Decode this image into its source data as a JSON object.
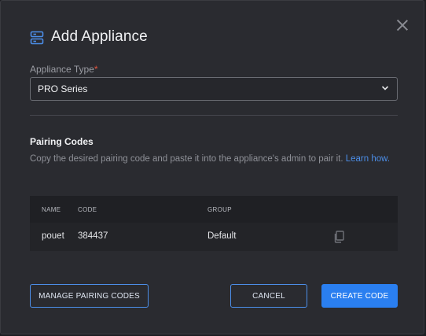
{
  "dialog": {
    "title": "Add Appliance",
    "title_icon": "server-stack-icon",
    "close_icon": "close-icon"
  },
  "appliance_type": {
    "label": "Appliance Type",
    "required_mark": "*",
    "selected": "PRO Series",
    "dropdown_icon": "chevron-down-icon"
  },
  "pairing": {
    "title": "Pairing Codes",
    "description": "Copy the desired pairing code and paste it into the appliance's admin to pair it. Learn how.",
    "learn_link": "Learn how."
  },
  "table": {
    "headers": [
      "NAME",
      "CODE",
      "GROUP"
    ],
    "rows": [
      {
        "name": "pouet",
        "code": "384437",
        "group": "Default",
        "action_icon": "copy-icon"
      }
    ]
  },
  "buttons": {
    "manage": "MANAGE PAIRING CODES",
    "cancel": "CANCEL",
    "create": "CREATE CODE"
  },
  "colors": {
    "accent": "#2a7ff0",
    "link": "#4c8ee8",
    "required": "#e0553f",
    "background": "#2a2b30"
  }
}
